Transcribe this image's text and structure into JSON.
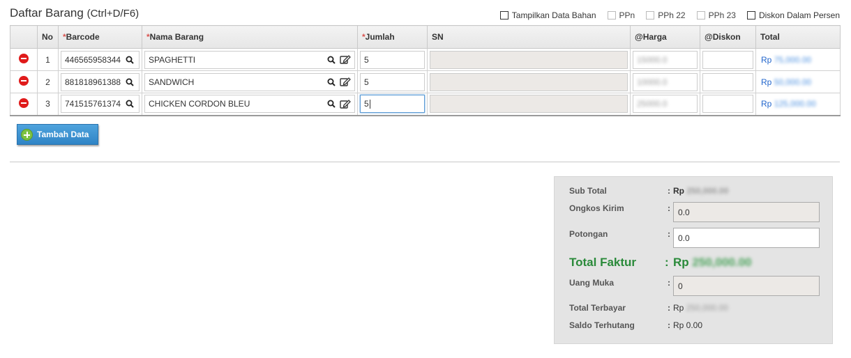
{
  "header": {
    "title": "Daftar Barang",
    "shortcut": "(Ctrl+D/F6)",
    "options": [
      {
        "label": "Tampilkan Data Bahan",
        "checked": false
      },
      {
        "label": "PPn",
        "checked": false
      },
      {
        "label": "PPh 22",
        "checked": false
      },
      {
        "label": "PPh 23",
        "checked": false
      },
      {
        "label": "Diskon Dalam Persen",
        "checked": false
      }
    ]
  },
  "table": {
    "columns": {
      "no": "No",
      "barcode_req": "*",
      "barcode": "Barcode",
      "nama_req": "*",
      "nama": "Nama Barang",
      "jumlah_req": "*",
      "jumlah": "Jumlah",
      "sn": "SN",
      "harga": "@Harga",
      "diskon": "@Diskon",
      "total": "Total"
    },
    "rows": [
      {
        "no": "1",
        "barcode": "446565958344",
        "nama": "SPAGHETTI",
        "jumlah": "5",
        "harga": "15000.0",
        "total_prefix": "Rp",
        "total": "75,000.00"
      },
      {
        "no": "2",
        "barcode": "881818961388",
        "nama": "SANDWICH",
        "jumlah": "5",
        "harga": "10000.0",
        "total_prefix": "Rp",
        "total": "50,000.00"
      },
      {
        "no": "3",
        "barcode": "741515761374",
        "nama": "CHICKEN CORDON BLEU",
        "jumlah": "5",
        "harga": "25000.0",
        "total_prefix": "Rp",
        "total": "125,000.00"
      }
    ]
  },
  "actions": {
    "add_label": "Tambah Data"
  },
  "summary": {
    "subtotal_label": "Sub Total",
    "subtotal_prefix": "Rp",
    "subtotal_value": "250,000.00",
    "ongkos_label": "Ongkos Kirim",
    "ongkos_value": "0.0",
    "potongan_label": "Potongan",
    "potongan_value": "0.0",
    "total_faktur_label": "Total Faktur",
    "total_faktur_prefix": "Rp",
    "total_faktur_value": "250,000.00",
    "uang_muka_label": "Uang Muka",
    "uang_muka_value": "0",
    "total_terbayar_label": "Total Terbayar",
    "total_terbayar_prefix": "Rp",
    "total_terbayar_value": "250,000.00",
    "saldo_label": "Saldo Terhutang",
    "saldo_value": "Rp 0.00",
    "colon": ":"
  }
}
